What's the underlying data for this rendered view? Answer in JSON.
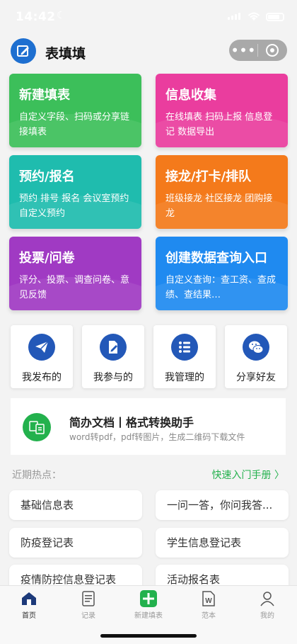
{
  "status_bar": {
    "time": "14:42"
  },
  "app": {
    "title": "表填填"
  },
  "capsule": {
    "more": "•••"
  },
  "cards": [
    {
      "title": "新建填表",
      "desc": "自定义字段、扫码或分享链接填表",
      "color": "#3cbf5a"
    },
    {
      "title": "信息收集",
      "desc": "在线填表 扫码上报 信息登记 数据导出",
      "color": "#ea3d9e"
    },
    {
      "title": "预约/报名",
      "desc": "预约 排号 报名 会议室预约 自定义预约",
      "color": "#1fbcae"
    },
    {
      "title": "接龙/打卡/排队",
      "desc": "班级接龙 社区接龙 团购接龙",
      "color": "#f47a1b"
    },
    {
      "title": "投票/问卷",
      "desc": "评分、投票、调查问卷、意见反馈",
      "color": "#a03ac3"
    },
    {
      "title": "创建数据查询入口",
      "desc": "自定义查询：查工资、查成绩、查结果…",
      "color": "#1f8af0"
    }
  ],
  "tiles": [
    {
      "label": "我发布的",
      "icon": "paper-plane-icon"
    },
    {
      "label": "我参与的",
      "icon": "document-edit-icon"
    },
    {
      "label": "我管理的",
      "icon": "list-icon"
    },
    {
      "label": "分享好友",
      "icon": "wechat-icon"
    }
  ],
  "banner": {
    "title": "简办文档丨格式转换助手",
    "subtitle": "word转pdf，pdf转图片，生成二维码下载文件",
    "icon": "convert-icon"
  },
  "hot": {
    "label": "近期热点：",
    "manual": "快速入门手册 〉"
  },
  "hot_items": [
    "基础信息表",
    "一问一答，你问我答...",
    "防疫登记表",
    "学生信息登记表",
    "疫情防控信息登记表",
    "活动报名表"
  ],
  "tabs": [
    {
      "label": "首页",
      "icon": "home-icon",
      "active": true
    },
    {
      "label": "记录",
      "icon": "record-icon"
    },
    {
      "label": "新建填表",
      "icon": "add-icon"
    },
    {
      "label": "范本",
      "icon": "template-icon"
    },
    {
      "label": "我的",
      "icon": "user-icon"
    }
  ],
  "colors": {
    "accent": "#23b14d",
    "tile_icon": "#2358b8"
  }
}
